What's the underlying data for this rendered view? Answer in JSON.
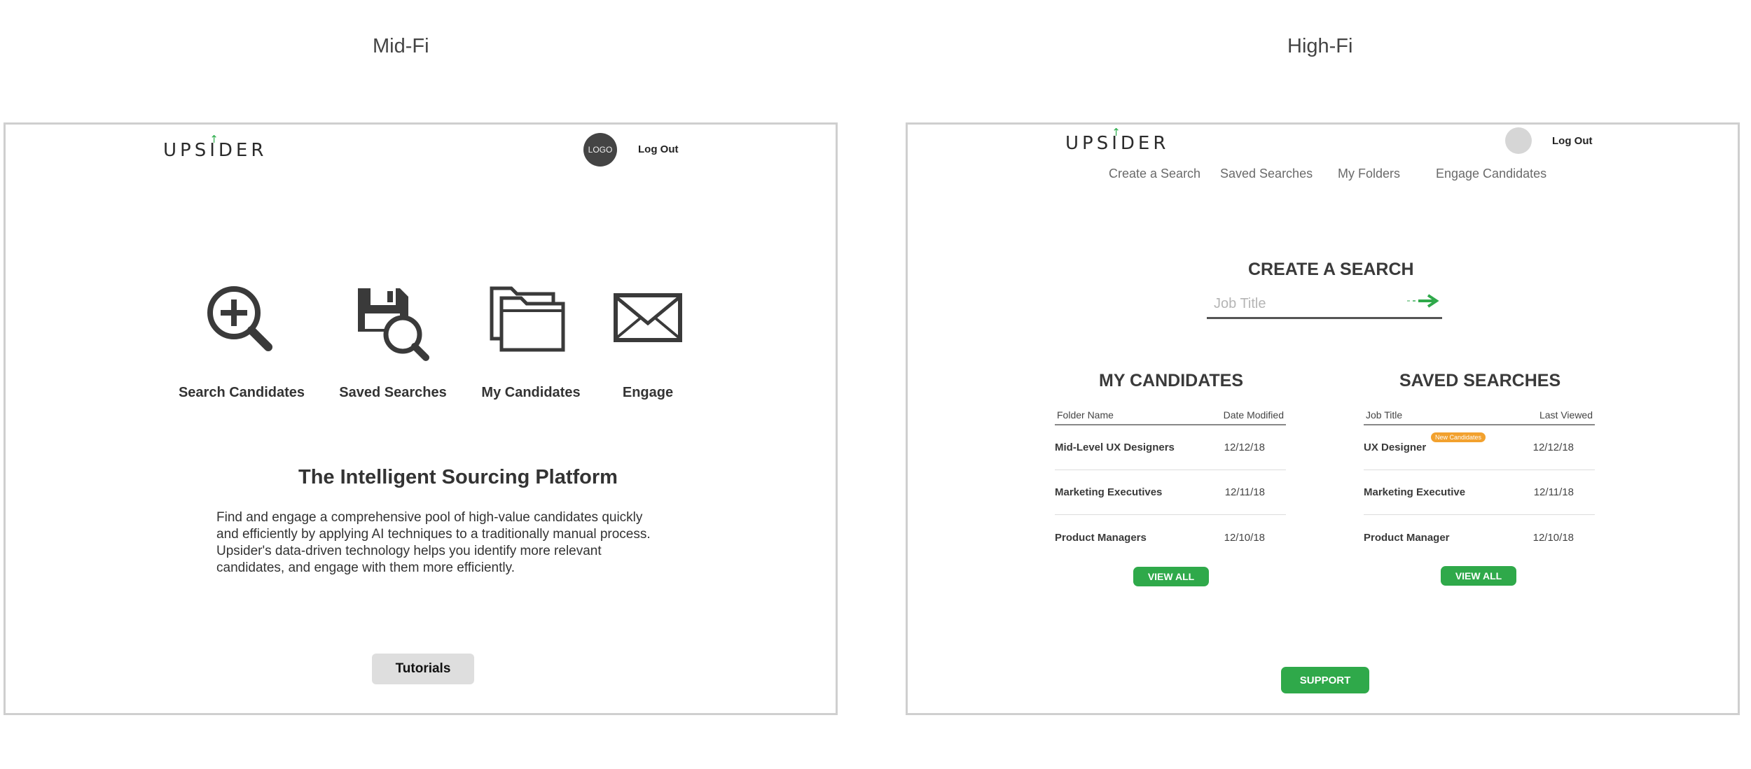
{
  "labels": {
    "mid": "Mid-Fi",
    "high": "High-Fi"
  },
  "brand": {
    "pre": "UPS",
    "i": "I",
    "post": "DER",
    "arrow": "↑"
  },
  "mid": {
    "logo_text": "LOGO",
    "logout": "Log Out",
    "features": [
      {
        "label": "Search Candidates",
        "icon": "search-plus-icon"
      },
      {
        "label": "Saved Searches",
        "icon": "saved-search-icon"
      },
      {
        "label": "My Candidates",
        "icon": "folders-icon"
      },
      {
        "label": "Engage",
        "icon": "envelope-icon"
      }
    ],
    "tagline": "The Intelligent Sourcing Platform",
    "description": "Find and engage a comprehensive pool of high-value candidates quickly and efficiently by applying AI techniques to a traditionally manual process. Upsider's data-driven technology helps you identify more relevant candidates, and engage with them more efficiently.",
    "tutorials": "Tutorials"
  },
  "high": {
    "logout": "Log Out",
    "nav": [
      "Create a Search",
      "Saved Searches",
      "My Folders",
      "Engage Candidates"
    ],
    "create_title": "CREATE A SEARCH",
    "search_placeholder": "Job Title",
    "candidates": {
      "title": "MY CANDIDATES",
      "columns": [
        "Folder Name",
        "Date Modified"
      ],
      "rows": [
        {
          "name": "Mid-Level UX Designers",
          "date": "12/12/18"
        },
        {
          "name": "Marketing Executives",
          "date": "12/11/18"
        },
        {
          "name": "Product Managers",
          "date": "12/10/18"
        }
      ],
      "view_all": "VIEW ALL"
    },
    "saved": {
      "title": "SAVED SEARCHES",
      "columns": [
        "Job Title",
        "Last Viewed"
      ],
      "rows": [
        {
          "name": "UX Designer",
          "date": "12/12/18",
          "badge": "New Candidates"
        },
        {
          "name": "Marketing Executive",
          "date": "12/11/18"
        },
        {
          "name": "Product Manager",
          "date": "12/10/18"
        }
      ],
      "view_all": "VIEW ALL"
    },
    "support": "SUPPORT"
  },
  "colors": {
    "accent": "#2fa94a",
    "badge": "#f2a12e",
    "frame_border": "#cfcfcf"
  }
}
